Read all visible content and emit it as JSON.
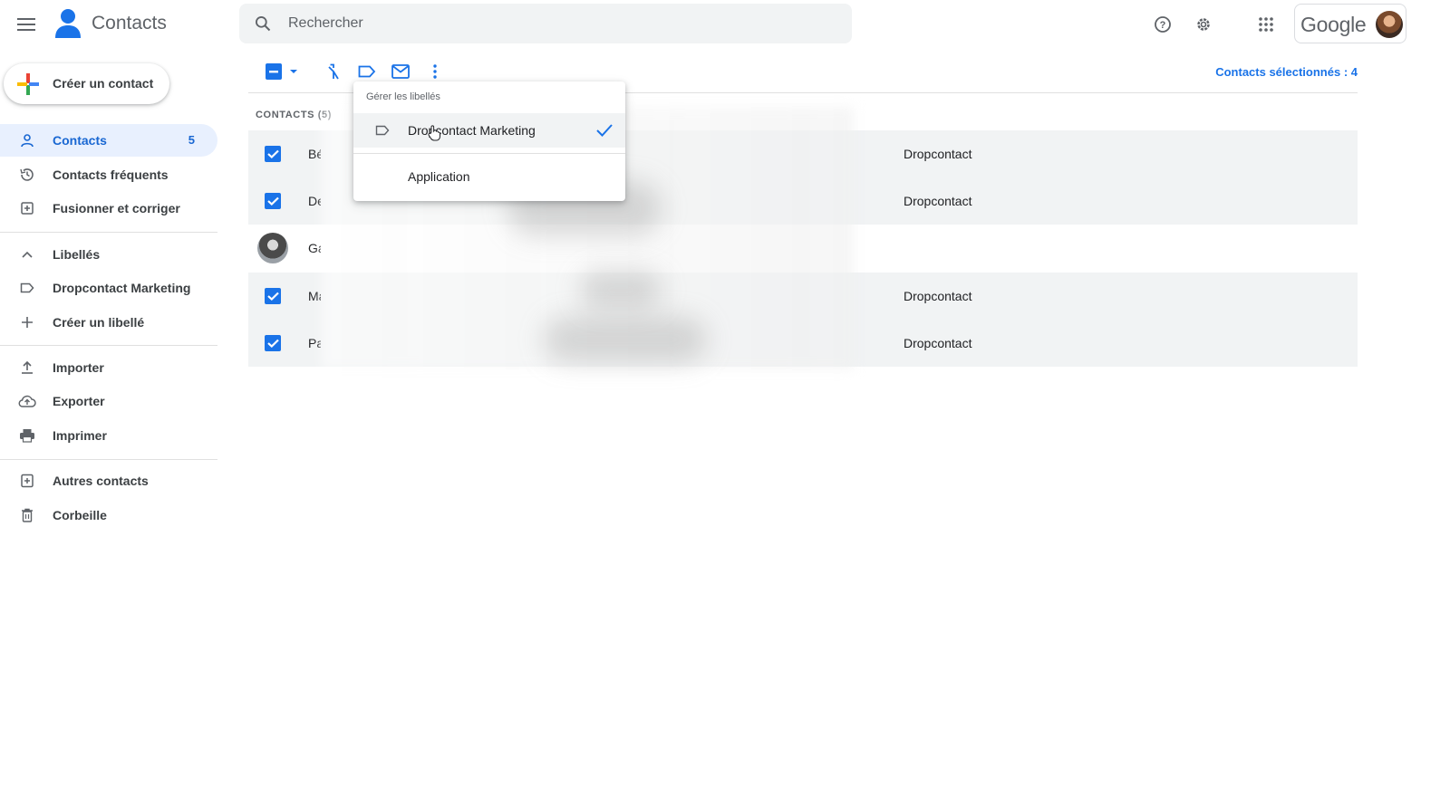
{
  "app": {
    "name": "Contacts"
  },
  "search": {
    "placeholder": "Rechercher"
  },
  "header": {
    "google_wordmark": "Google"
  },
  "sidebar": {
    "create_label": "Créer un contact",
    "items": [
      {
        "label": "Contacts",
        "count": "5",
        "icon": "person-icon",
        "active": true
      },
      {
        "label": "Contacts fréquents",
        "icon": "history-icon"
      },
      {
        "label": "Fusionner et corriger",
        "icon": "merge-icon"
      }
    ],
    "labels_section": {
      "title": "Libellés",
      "items": [
        {
          "label": "Dropcontact Marketing",
          "icon": "label-icon"
        },
        {
          "label": "Créer un libellé",
          "icon": "plus-icon"
        }
      ]
    },
    "tools": [
      {
        "label": "Importer",
        "icon": "upload-icon"
      },
      {
        "label": "Exporter",
        "icon": "cloud-upload-icon"
      },
      {
        "label": "Imprimer",
        "icon": "print-icon"
      }
    ],
    "other": [
      {
        "label": "Autres contacts",
        "icon": "other-contacts-icon"
      },
      {
        "label": "Corbeille",
        "icon": "trash-icon"
      }
    ]
  },
  "toolbar": {
    "selected_text": "Contacts sélectionnés : 4"
  },
  "list": {
    "title": "CONTACTS (5)",
    "rows": [
      {
        "name": "Bé",
        "label": "Dropcontact",
        "selected": true
      },
      {
        "name": "De",
        "label": "Dropcontact",
        "selected": true
      },
      {
        "name": "Ga",
        "label": "",
        "selected": false
      },
      {
        "name": "Ma",
        "label": "Dropcontact",
        "selected": true
      },
      {
        "name": "Pa",
        "label": "Dropcontact",
        "selected": true
      }
    ]
  },
  "label_menu": {
    "header": "Gérer les libellés",
    "items": [
      {
        "label": "Dropcontact Marketing",
        "checked": true
      },
      {
        "label": "Application",
        "checked": false
      }
    ]
  },
  "colors": {
    "accent": "#1a73e8",
    "active_bg": "#e8f0fe",
    "selected_row": "#f1f3f4"
  }
}
